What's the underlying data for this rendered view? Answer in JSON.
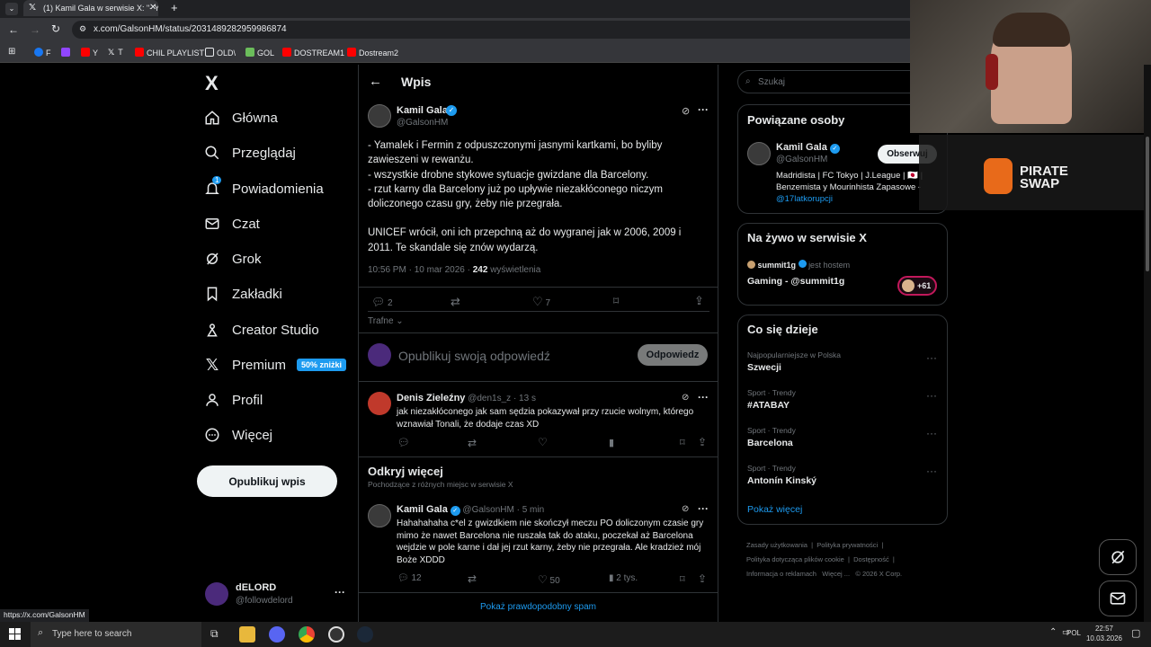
{
  "browser": {
    "tab_title": "(1) Kamil Gala w serwisie X: \"- Ya",
    "url": "x.com/GalsonHM/status/2031489282959986874",
    "bookmarks": [
      "F",
      "",
      "Y",
      "T",
      "CHIL PLAYLIST",
      "OLD\\",
      "GOL",
      "DOSTREAM1",
      "Dostream2"
    ],
    "status_url": "https://x.com/GalsonHM"
  },
  "sidebar": {
    "logo": "X",
    "items": [
      {
        "label": "Główna",
        "icon": "home-icon"
      },
      {
        "label": "Przeglądaj",
        "icon": "search-icon"
      },
      {
        "label": "Powiadomienia",
        "icon": "bell-icon",
        "badge": "1"
      },
      {
        "label": "Czat",
        "icon": "mail-icon"
      },
      {
        "label": "Grok",
        "icon": "grok-icon"
      },
      {
        "label": "Zakładki",
        "icon": "bookmark-icon"
      },
      {
        "label": "Creator Studio",
        "icon": "creator-icon"
      },
      {
        "label": "Premium",
        "icon": "x-icon",
        "badge": "50% zniżki"
      },
      {
        "label": "Profil",
        "icon": "person-icon"
      },
      {
        "label": "Więcej",
        "icon": "more-circle-icon"
      }
    ],
    "publish": "Opublikuj wpis",
    "account": {
      "name": "dELORD",
      "handle": "@followdelord"
    }
  },
  "post": {
    "header": "Wpis",
    "author": "Kamil Gala",
    "handle": "@GalsonHM",
    "text_lines": [
      "- Yamalek i Fermin z odpuszczonymi jasnymi kartkami, bo byliby",
      "zawieszeni w rewanżu.",
      "- wszystkie drobne stykowe sytuacje gwizdane dla Barcelony.",
      "- rzut karny dla Barcelony już po upływie niezakłóconego niczym",
      "doliczonego czasu gry, żeby nie przegrała.",
      "",
      "UNICEF wrócił, oni ich przepchną aż do wygranej jak w 2006, 2009 i",
      "2011. Te skandale się znów wydarzą."
    ],
    "time": "10:56 PM · 10 mar 2026 · ",
    "views": "242",
    "views_label": " wyświetlenia",
    "replies": "2",
    "likes": "7",
    "sort": "Trafne",
    "reply_placeholder": "Opublikuj swoją odpowiedź",
    "reply_button": "Odpowiedz"
  },
  "reply": {
    "author": "Denis Zieleźny",
    "handle": "@den1s_z · 13 s",
    "text_lines": [
      "jak niezakłóconego jak sam sędzia pokazywał przy rzucie wolnym, którego",
      "wznawiał Tonali, że dodaje czas XD"
    ]
  },
  "discover": {
    "title": "Odkryj więcej",
    "subtitle": "Pochodzące z różnych miejsc w serwisie X",
    "author": "Kamil Gala",
    "handle": "@GalsonHM · 5 min",
    "text_lines": [
      "Hahahahaha c*el z gwizdkiem nie skończył meczu PO doliczonym czasie gry",
      "mimo że nawet Barcelona nie ruszała tak do ataku, poczekał aż Barcelona",
      "wejdzie w pole karne i dał jej rzut karny, żeby nie przegrała. Ale kradzież mój",
      "Boże XDDD"
    ],
    "replies": "12",
    "likes": "50",
    "views": "2 tys.",
    "spam_link": "Pokaż prawdopodobny spam"
  },
  "right": {
    "search_placeholder": "Szukaj",
    "related_title": "Powiązane osoby",
    "related_name": "Kamil Gala",
    "related_handle": "@GalsonHM",
    "follow": "Obserwuj",
    "bio_lines": [
      "Madridista | FC Tokyo | J.League | 🇯🇵 |",
      "Benzemista y Mourinhista Zapasowe -"
    ],
    "bio_link": "@17latkorupcji",
    "live_title": "Na żywo w serwisie X",
    "live_host": "summit1g",
    "live_host_suffix": "jest hostem",
    "live_stream": "Gaming - @summit1g",
    "live_count": "+61",
    "trends_title": "Co się dzieje",
    "trends": [
      {
        "context": "Najpopularniejsze w Polska",
        "name": "Szwecji"
      },
      {
        "context": "Sport · Trendy",
        "name": "#ATABAY"
      },
      {
        "context": "Sport · Trendy",
        "name": "Barcelona"
      },
      {
        "context": "Sport · Trendy",
        "name": "Antonín Kinský"
      }
    ],
    "show_more": "Pokaż więcej",
    "footer_line1": [
      "Zasady użytkowania",
      "|",
      "Polityka prywatności",
      "|"
    ],
    "footer_line2": [
      "Polityka dotycząca plików cookie",
      "|",
      "Dostępność",
      "|"
    ],
    "footer_line3": [
      "Informacja o reklamach",
      "Więcej ...",
      "© 2026 X Corp."
    ]
  },
  "overlay": {
    "sponsor": "PIRATE SWAP"
  },
  "taskbar": {
    "search": "Type here to search",
    "lang": "POL",
    "time": "22:57",
    "date": "10.03.2026"
  }
}
